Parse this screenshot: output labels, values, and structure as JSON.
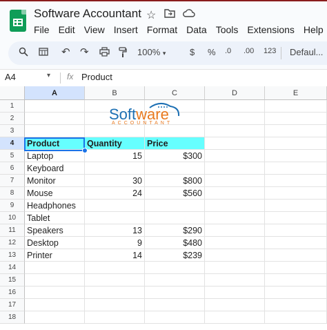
{
  "app": {
    "title": "Software Accountant"
  },
  "menu": [
    "File",
    "Edit",
    "View",
    "Insert",
    "Format",
    "Data",
    "Tools",
    "Extensions",
    "Help"
  ],
  "toolbar": {
    "zoom": "100%",
    "currency": "$",
    "percent": "%",
    "dec_less": ".0",
    "dec_more": ".00",
    "number_format": "123",
    "font": "Defaul..."
  },
  "namebox": {
    "cell": "A4",
    "fx": "fx",
    "value": "Product"
  },
  "columns": [
    "A",
    "B",
    "C",
    "D",
    "E"
  ],
  "rows": [
    "1",
    "2",
    "3",
    "4",
    "5",
    "6",
    "7",
    "8",
    "9",
    "10",
    "11",
    "12",
    "13",
    "14",
    "15",
    "16",
    "17",
    "18"
  ],
  "logo": {
    "part1": "Soft",
    "part2": "ware",
    "tagline": "ACCOUNTANT"
  },
  "table": {
    "headers": [
      "Product",
      "Quantity",
      "Price"
    ],
    "data": [
      [
        "Laptop",
        "15",
        "$300"
      ],
      [
        "Keyboard",
        "",
        ""
      ],
      [
        "Monitor",
        "30",
        "$800"
      ],
      [
        "Mouse",
        "24",
        "$560"
      ],
      [
        "Headphones",
        "",
        ""
      ],
      [
        "Tablet",
        "",
        ""
      ],
      [
        "Speakers",
        "13",
        "$290"
      ],
      [
        "Desktop",
        "9",
        "$480"
      ],
      [
        "Printer",
        "14",
        "$239"
      ]
    ]
  }
}
